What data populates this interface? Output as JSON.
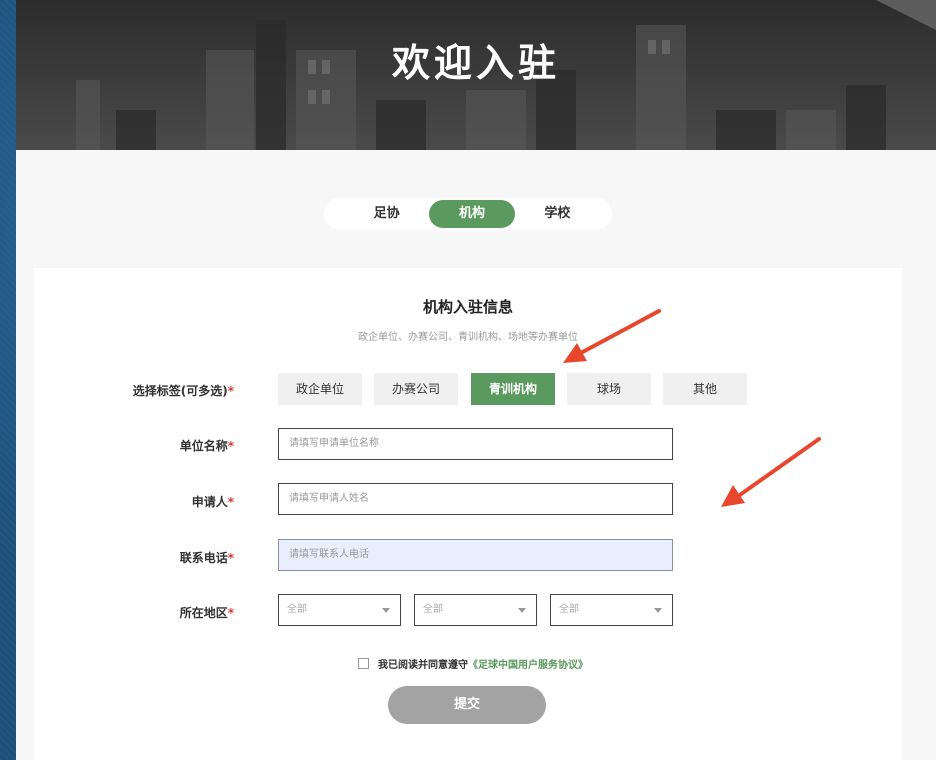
{
  "banner": {
    "title": "欢迎入驻"
  },
  "tabs": [
    {
      "label": "足协",
      "active": false
    },
    {
      "label": "机构",
      "active": true
    },
    {
      "label": "学校",
      "active": false
    }
  ],
  "form": {
    "title": "机构入驻信息",
    "subtitle": "政企单位、办赛公司、青训机构、场地等办赛单位",
    "tags_label": "选择标签(可多选)",
    "tags": [
      {
        "label": "政企单位",
        "active": false
      },
      {
        "label": "办赛公司",
        "active": false
      },
      {
        "label": "青训机构",
        "active": true
      },
      {
        "label": "球场",
        "active": false
      },
      {
        "label": "其他",
        "active": false
      }
    ],
    "org_name_label": "单位名称",
    "org_name_placeholder": "请填写申请单位名称",
    "applicant_label": "申请人",
    "applicant_placeholder": "请填写申请人姓名",
    "phone_label": "联系电话",
    "phone_placeholder": "请填写联系人电话",
    "region_label": "所在地区",
    "region_selects": [
      "全部",
      "全部",
      "全部"
    ],
    "required_mark": "*",
    "agree_text": "我已阅读并同意遵守",
    "agree_link": "《足球中国用户服务协议》",
    "submit_label": "提交"
  },
  "colors": {
    "accent": "#5a9a5e",
    "required": "#dd3333",
    "arrow": "#e8472e"
  }
}
